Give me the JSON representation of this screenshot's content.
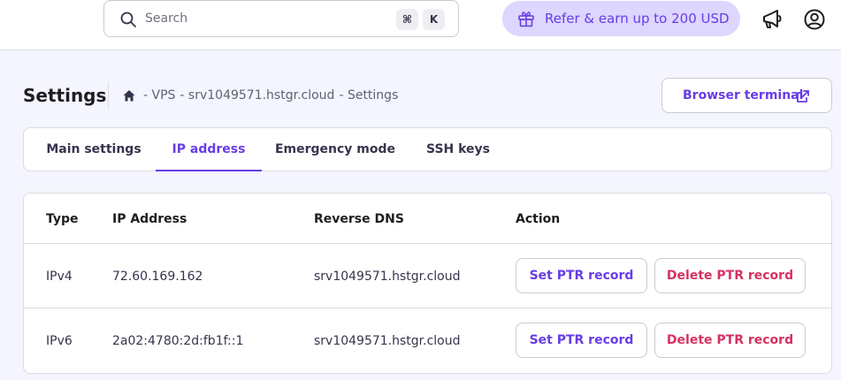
{
  "header": {
    "search_placeholder": "Search",
    "shortcut_cmd": "⌘",
    "shortcut_key": "K",
    "refer_label": "Refer & earn up to 200 USD"
  },
  "page": {
    "title": "Settings",
    "breadcrumb": [
      "- VPS",
      "- srv1049571.hstgr.cloud",
      "- Settings"
    ],
    "terminal_button": "Browser terminal"
  },
  "tabs": [
    {
      "label": "Main settings",
      "active": false
    },
    {
      "label": "IP address",
      "active": true
    },
    {
      "label": "Emergency mode",
      "active": false
    },
    {
      "label": "SSH keys",
      "active": false
    }
  ],
  "table": {
    "headers": [
      "Type",
      "IP Address",
      "Reverse DNS",
      "Action"
    ],
    "rows": [
      {
        "type": "IPv4",
        "ip": "72.60.169.162",
        "rdns": "srv1049571.hstgr.cloud",
        "ptr_label": "Set PTR record",
        "delete_label": "Delete PTR record"
      },
      {
        "type": "IPv6",
        "ip": "2a02:4780:2d:fb1f::1",
        "rdns": "srv1049571.hstgr.cloud",
        "ptr_label": "Set PTR record",
        "delete_label": "Delete PTR record"
      }
    ]
  },
  "colors": {
    "accent": "#673de6",
    "danger": "#d63163",
    "refer_bg": "#ddd6fe",
    "page_bg": "#f4f5ff"
  },
  "icons": [
    "search-icon",
    "gift-icon",
    "megaphone-icon",
    "account-icon",
    "home-icon",
    "external-link-icon"
  ]
}
